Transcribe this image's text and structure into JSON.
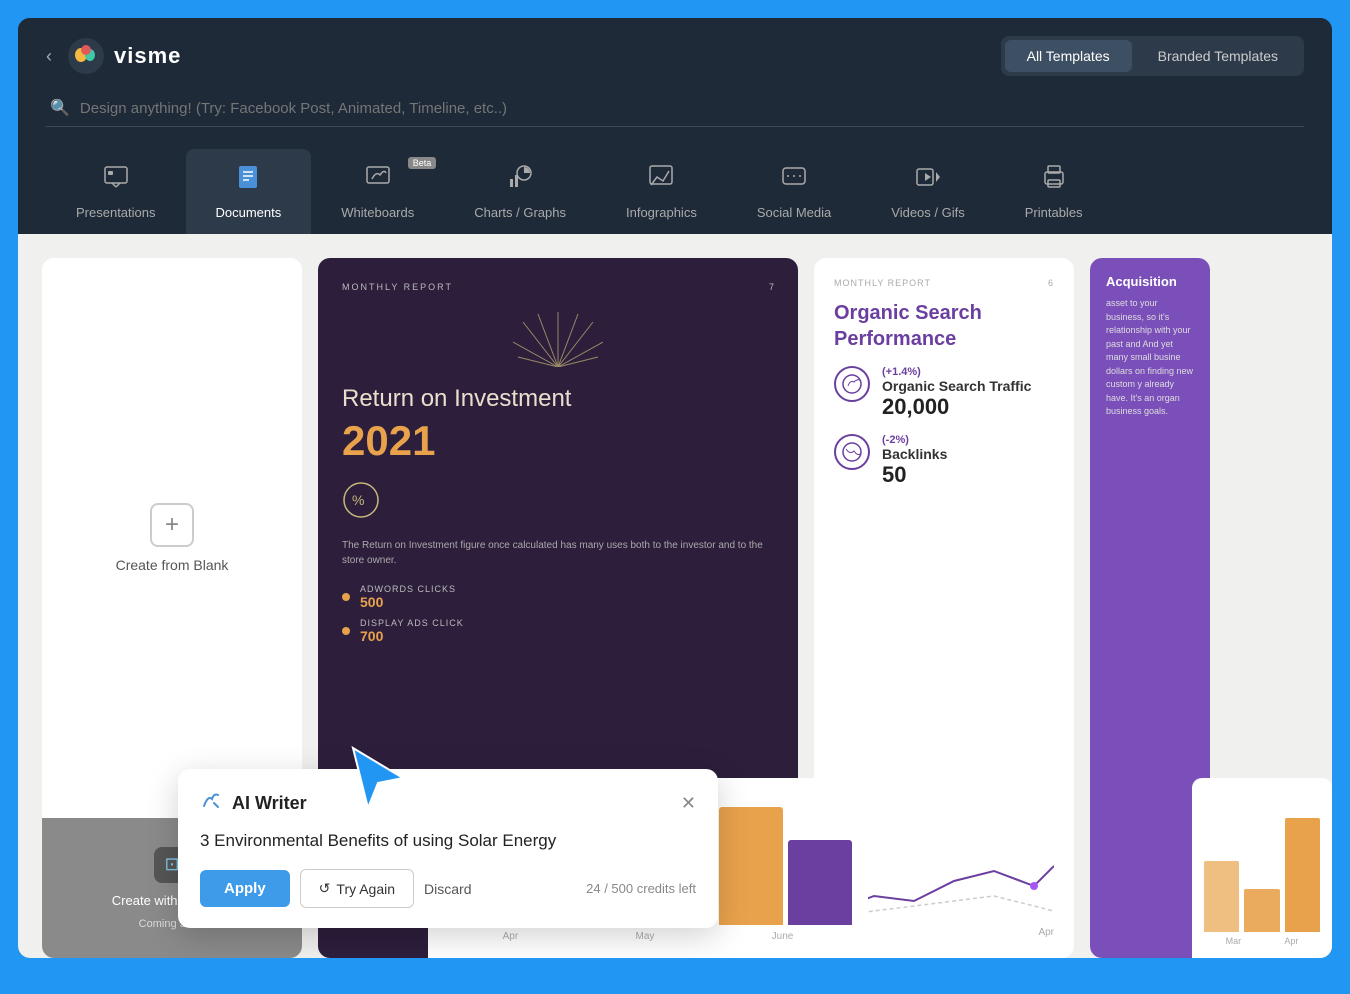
{
  "app": {
    "name": "visme",
    "back_label": "‹"
  },
  "header": {
    "tabs": [
      {
        "id": "all-templates",
        "label": "All Templates",
        "active": true
      },
      {
        "id": "branded-templates",
        "label": "Branded Templates",
        "active": false
      }
    ],
    "search": {
      "placeholder": "Design anything! (Try: Facebook Post, Animated, Timeline, etc..)"
    }
  },
  "nav": {
    "tabs": [
      {
        "id": "presentations",
        "label": "Presentations",
        "icon": "▦",
        "active": false,
        "beta": false
      },
      {
        "id": "documents",
        "label": "Documents",
        "icon": "📄",
        "active": true,
        "beta": false
      },
      {
        "id": "whiteboards",
        "label": "Whiteboards",
        "icon": "✏",
        "active": false,
        "beta": true
      },
      {
        "id": "charts-graphs",
        "label": "Charts / Graphs",
        "icon": "📊",
        "active": false,
        "beta": false
      },
      {
        "id": "infographics",
        "label": "Infographics",
        "icon": "📈",
        "active": false,
        "beta": false
      },
      {
        "id": "social-media",
        "label": "Social Media",
        "icon": "💬",
        "active": false,
        "beta": false
      },
      {
        "id": "videos-gifs",
        "label": "Videos / Gifs",
        "icon": "▶",
        "active": false,
        "beta": false
      },
      {
        "id": "printables",
        "label": "Printables",
        "icon": "🖨",
        "active": false,
        "beta": false
      }
    ]
  },
  "blank_card": {
    "create_label": "Create from Blank",
    "ai_label": "Create with Visme AI",
    "coming_soon": "Coming Soon"
  },
  "template1": {
    "monthly_report": "MONTHLY REPORT",
    "page_num": "7",
    "roi_title": "Return on Investment",
    "roi_year": "2021",
    "desc": "The Return on Investment figure once calculated has many uses both to the investor and to the store owner.",
    "metric1_label": "ADWORDS CLICKS",
    "metric1_value": "500",
    "metric2_label": "DISPLAY ADS CLICK",
    "metric2_value": "700"
  },
  "template2": {
    "monthly_report": "MONTHLY REPORT",
    "page_num": "6",
    "title": "Organic Search Performance",
    "metric1_change": "(+1.4%)",
    "metric1_name": "Organic Search Traffic",
    "metric1_value": "20,000",
    "metric2_change": "(-2%)",
    "metric2_name": "Backlinks",
    "metric2_value": "50",
    "chart_months": [
      "Mar",
      "Apr"
    ]
  },
  "ai_writer": {
    "title": "AI Writer",
    "content": "3 Environmental Benefits of using Solar Energy",
    "apply_label": "Apply",
    "try_again_label": "Try Again",
    "discard_label": "Discard",
    "credits_used": "24",
    "credits_total": "500",
    "credits_label": "credits left"
  }
}
